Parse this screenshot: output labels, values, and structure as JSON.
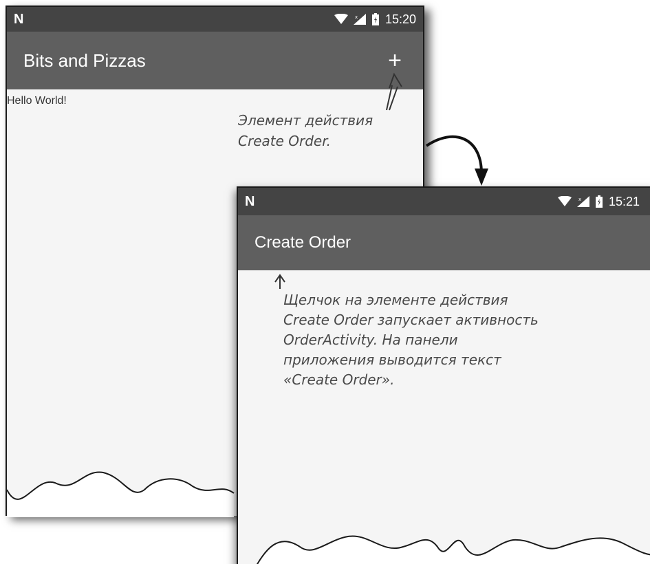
{
  "screen1": {
    "status_time": "15:20",
    "status_logo": "N",
    "app_title": "Bits and Pizzas",
    "action_icon": "plus-icon",
    "action_label": "+",
    "body_text": "Hello World!"
  },
  "screen2": {
    "status_time": "15:21",
    "status_logo": "N",
    "app_title": "Create Order"
  },
  "annotations": {
    "action_note": "Элемент действия Create Order.",
    "result_note": "Щелчок на элементе действия Create Order запускает активность OrderActivity. На панели приложения выводится текст «Create Order»."
  },
  "colors": {
    "statusbar": "#444444",
    "appbar": "#5f5f5f",
    "screen_bg": "#f5f5f5",
    "annotation": "#4a4a4a"
  }
}
